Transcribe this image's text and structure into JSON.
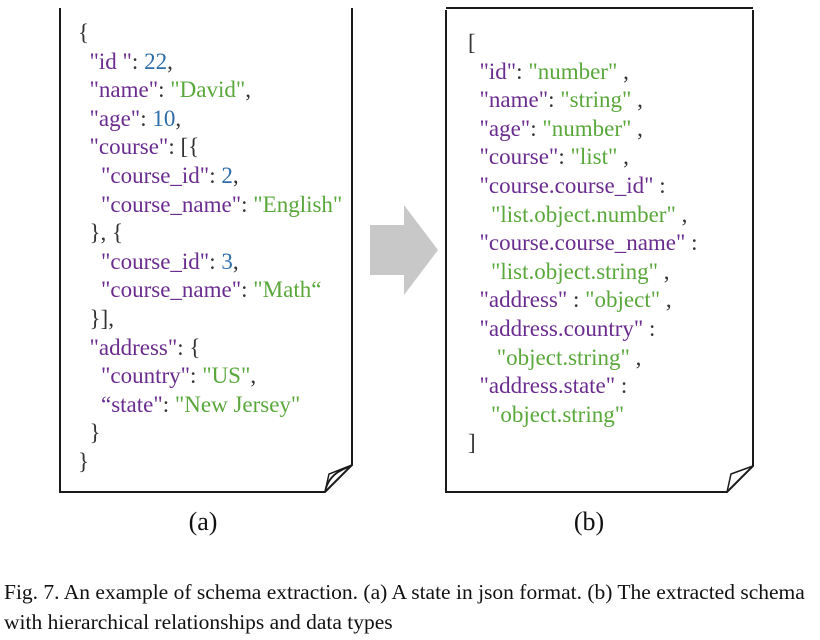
{
  "panel_a": {
    "lines": [
      [
        {
          "t": "{",
          "c": "punc"
        }
      ],
      [
        {
          "t": "  ",
          "c": "punc"
        },
        {
          "t": "\"id \"",
          "c": "key"
        },
        {
          "t": ": ",
          "c": "punc"
        },
        {
          "t": "22",
          "c": "num"
        },
        {
          "t": ",",
          "c": "punc"
        }
      ],
      [
        {
          "t": "  ",
          "c": "punc"
        },
        {
          "t": "\"name\"",
          "c": "key"
        },
        {
          "t": ": ",
          "c": "punc"
        },
        {
          "t": "\"David\"",
          "c": "str"
        },
        {
          "t": ",",
          "c": "punc"
        }
      ],
      [
        {
          "t": "  ",
          "c": "punc"
        },
        {
          "t": "\"age\"",
          "c": "key"
        },
        {
          "t": ": ",
          "c": "punc"
        },
        {
          "t": "10",
          "c": "num"
        },
        {
          "t": ",",
          "c": "punc"
        }
      ],
      [
        {
          "t": "  ",
          "c": "punc"
        },
        {
          "t": "\"course\"",
          "c": "key"
        },
        {
          "t": ": [{",
          "c": "punc"
        }
      ],
      [
        {
          "t": "    ",
          "c": "punc"
        },
        {
          "t": "\"course_id\"",
          "c": "key"
        },
        {
          "t": ": ",
          "c": "punc"
        },
        {
          "t": "2",
          "c": "num"
        },
        {
          "t": ",",
          "c": "punc"
        }
      ],
      [
        {
          "t": "    ",
          "c": "punc"
        },
        {
          "t": "\"course_name\"",
          "c": "key"
        },
        {
          "t": ": ",
          "c": "punc"
        },
        {
          "t": "\"English\"",
          "c": "str"
        }
      ],
      [
        {
          "t": "  }, {",
          "c": "punc"
        }
      ],
      [
        {
          "t": "    ",
          "c": "punc"
        },
        {
          "t": "\"course_id\"",
          "c": "key"
        },
        {
          "t": ": ",
          "c": "punc"
        },
        {
          "t": "3",
          "c": "num"
        },
        {
          "t": ",",
          "c": "punc"
        }
      ],
      [
        {
          "t": "    ",
          "c": "punc"
        },
        {
          "t": "\"course_name\"",
          "c": "key"
        },
        {
          "t": ": ",
          "c": "punc"
        },
        {
          "t": "\"Math“",
          "c": "str"
        }
      ],
      [
        {
          "t": "  }],",
          "c": "punc"
        }
      ],
      [
        {
          "t": "  ",
          "c": "punc"
        },
        {
          "t": "\"address\"",
          "c": "key"
        },
        {
          "t": ": {",
          "c": "punc"
        }
      ],
      [
        {
          "t": "    ",
          "c": "punc"
        },
        {
          "t": "\"country\"",
          "c": "key"
        },
        {
          "t": ": ",
          "c": "punc"
        },
        {
          "t": "\"US\"",
          "c": "str"
        },
        {
          "t": ",",
          "c": "punc"
        }
      ],
      [
        {
          "t": "    ",
          "c": "punc"
        },
        {
          "t": "“state\"",
          "c": "key"
        },
        {
          "t": ": ",
          "c": "punc"
        },
        {
          "t": "\"New Jersey\"",
          "c": "str"
        }
      ],
      [
        {
          "t": "  }",
          "c": "punc"
        }
      ],
      [
        {
          "t": "}",
          "c": "punc"
        }
      ]
    ],
    "label": "(a)"
  },
  "panel_b": {
    "lines": [
      [
        {
          "t": "[",
          "c": "punc"
        }
      ],
      [
        {
          "t": "  ",
          "c": "punc"
        },
        {
          "t": "\"id\"",
          "c": "key"
        },
        {
          "t": ": ",
          "c": "punc"
        },
        {
          "t": "\"number\"",
          "c": "str"
        },
        {
          "t": " ,",
          "c": "punc"
        }
      ],
      [
        {
          "t": "  ",
          "c": "punc"
        },
        {
          "t": "\"name\"",
          "c": "key"
        },
        {
          "t": ": ",
          "c": "punc"
        },
        {
          "t": "\"string\"",
          "c": "str"
        },
        {
          "t": " ,",
          "c": "punc"
        }
      ],
      [
        {
          "t": "  ",
          "c": "punc"
        },
        {
          "t": "\"age\"",
          "c": "key"
        },
        {
          "t": ": ",
          "c": "punc"
        },
        {
          "t": "\"number\"",
          "c": "str"
        },
        {
          "t": " ,",
          "c": "punc"
        }
      ],
      [
        {
          "t": "  ",
          "c": "punc"
        },
        {
          "t": "\"course\"",
          "c": "key"
        },
        {
          "t": ": ",
          "c": "punc"
        },
        {
          "t": "\"list\"",
          "c": "str"
        },
        {
          "t": " ,",
          "c": "punc"
        }
      ],
      [
        {
          "t": "  ",
          "c": "punc"
        },
        {
          "t": "\"course.course_id\"",
          "c": "key"
        },
        {
          "t": " :",
          "c": "punc"
        }
      ],
      [
        {
          "t": "    ",
          "c": "punc"
        },
        {
          "t": "\"list.object.number\"",
          "c": "str"
        },
        {
          "t": " ,",
          "c": "punc"
        }
      ],
      [
        {
          "t": "  ",
          "c": "punc"
        },
        {
          "t": "\"course.course_name\"",
          "c": "key"
        },
        {
          "t": " :",
          "c": "punc"
        }
      ],
      [
        {
          "t": "    ",
          "c": "punc"
        },
        {
          "t": "\"list.object.string\"",
          "c": "str"
        },
        {
          "t": " ,",
          "c": "punc"
        }
      ],
      [
        {
          "t": "  ",
          "c": "punc"
        },
        {
          "t": "\"address\"",
          "c": "key"
        },
        {
          "t": " : ",
          "c": "punc"
        },
        {
          "t": "\"object\"",
          "c": "str"
        },
        {
          "t": " ,",
          "c": "punc"
        }
      ],
      [
        {
          "t": "  ",
          "c": "punc"
        },
        {
          "t": "\"address.country\"",
          "c": "key"
        },
        {
          "t": " :",
          "c": "punc"
        }
      ],
      [
        {
          "t": "     ",
          "c": "punc"
        },
        {
          "t": "\"object.string\"",
          "c": "str"
        },
        {
          "t": " ,",
          "c": "punc"
        }
      ],
      [
        {
          "t": "  ",
          "c": "punc"
        },
        {
          "t": "\"address.state\"",
          "c": "key"
        },
        {
          "t": " :",
          "c": "punc"
        }
      ],
      [
        {
          "t": "    ",
          "c": "punc"
        },
        {
          "t": "\"object.string\"",
          "c": "str"
        }
      ],
      [
        {
          "t": "]",
          "c": "punc"
        }
      ]
    ],
    "label": "(b)"
  },
  "caption": "Fig. 7.   An example of schema extraction. (a) A state in json format. (b) The extracted schema with hierarchical relationships and data types",
  "colors": {
    "key": "#6a2c8f",
    "string": "#5aa83c",
    "number": "#2e6da8",
    "arrow": "#c8c8c8"
  },
  "icons": {
    "document_a": "folded-corner-document-icon",
    "transform": "right-arrow-icon",
    "document_b": "folded-corner-document-icon"
  }
}
